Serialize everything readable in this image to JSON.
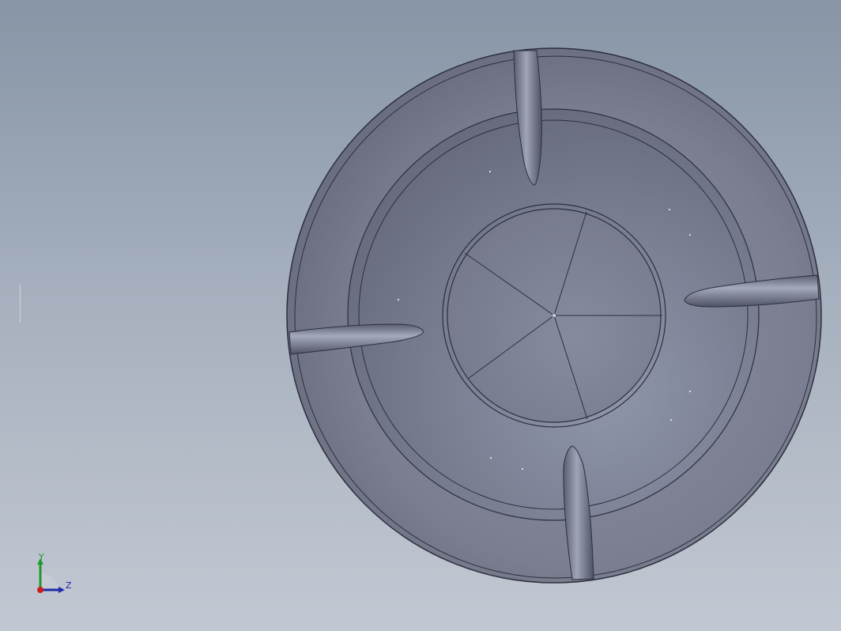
{
  "viewport": {
    "background_top": "#8795a6",
    "background_bottom": "#c2c8d2",
    "part_color": "#7c8092",
    "edge_color": "#2c2f3c"
  },
  "part": {
    "name": "dish",
    "fin_count": 4,
    "hub_segment_lines": 5
  },
  "triad": {
    "y_label": "Y",
    "z_label": "Z",
    "y_color": "#1e9a2a",
    "z_color": "#1e2aa8",
    "origin_color": "#c81e1e"
  }
}
